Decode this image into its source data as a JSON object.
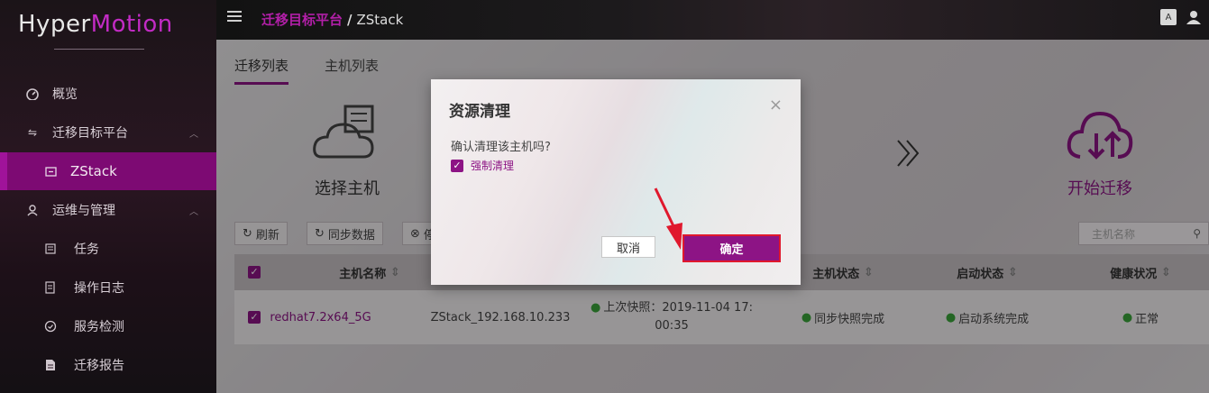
{
  "app": {
    "logo_prefix": "Hyper",
    "logo_suffix": "Motion"
  },
  "sidebar": {
    "items": [
      {
        "label": "概览",
        "icon": "dashboard-icon"
      },
      {
        "label": "迁移目标平台",
        "icon": "swap-icon"
      },
      {
        "label": "ZStack",
        "icon": "folder-icon"
      },
      {
        "label": "运维与管理",
        "icon": "user-manage-icon"
      },
      {
        "label": "任务",
        "icon": "task-list-icon"
      },
      {
        "label": "操作日志",
        "icon": "log-icon"
      },
      {
        "label": "服务检测",
        "icon": "service-check-icon"
      },
      {
        "label": "迁移报告",
        "icon": "report-icon"
      }
    ]
  },
  "header": {
    "breadcrumb_first": "迁移目标平台",
    "breadcrumb_sep": "/",
    "breadcrumb_current": "ZStack"
  },
  "main": {
    "tabs": [
      {
        "label": "迁移列表"
      },
      {
        "label": "主机列表"
      }
    ],
    "steps": {
      "select_host": "选择主机",
      "start_migration": "开始迁移"
    },
    "toolbar": {
      "refresh": "刷新",
      "sync": "同步数据",
      "partial": "停"
    },
    "search_placeholder": "主机名称",
    "table": {
      "headers": [
        "主机名称",
        "主机状态",
        "启动状态",
        "健康状况"
      ],
      "row": {
        "host_name": "redhat7.2x64_5G",
        "address": "ZStack_192.168.10.233",
        "snapshot_line1": "上次快照：2019-11-04 17:",
        "snapshot_line2": "00:35",
        "host_status": "同步快照完成",
        "boot_status": "启动系统完成",
        "health": "正常"
      }
    }
  },
  "modal": {
    "title": "资源清理",
    "message": "确认清理该主机吗?",
    "force_label": "强制清理",
    "cancel": "取消",
    "confirm": "确定"
  },
  "colors": {
    "brand": "#8d1485",
    "highlight": "#e0182d"
  }
}
